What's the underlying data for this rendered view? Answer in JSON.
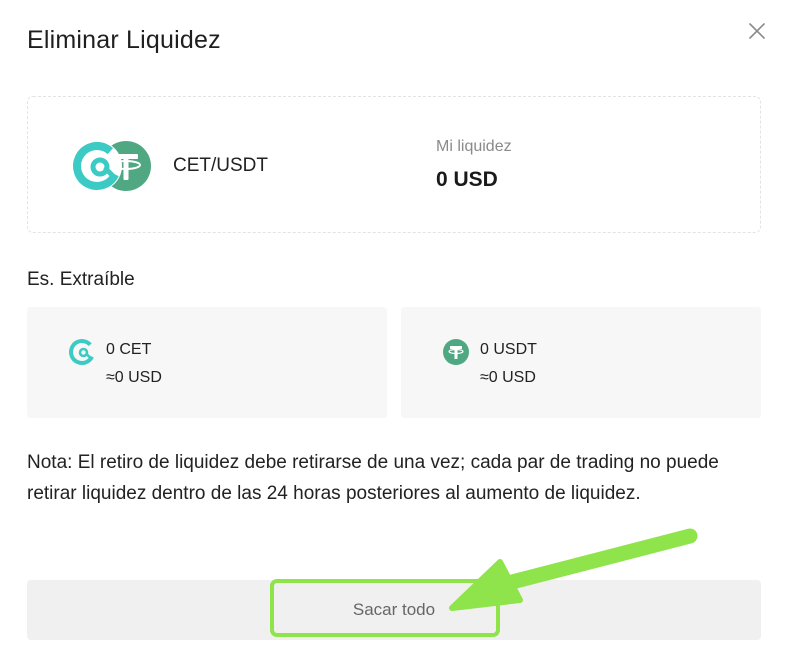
{
  "modal": {
    "title": "Eliminar Liquidez",
    "close_icon": "close-icon"
  },
  "pool": {
    "pair": "CET/USDT",
    "liquidity_label": "Mi liquidez",
    "liquidity_value": "0 USD"
  },
  "withdrawable": {
    "label": "Es. Extraíble",
    "assets": [
      {
        "amount": "0 CET",
        "usd": "≈0 USD",
        "icon": "cet-coin-icon"
      },
      {
        "amount": "0 USDT",
        "usd": "≈0 USD",
        "icon": "usdt-coin-icon"
      }
    ]
  },
  "note": "Nota: El retiro de liquidez debe retirarse de una vez; cada par de trading no puede retirar liquidez dentro de las 24 horas posteriores al aumento de liquidez.",
  "actions": {
    "withdraw_all_label": "Sacar todo"
  },
  "colors": {
    "cet_teal": "#3ccbc4",
    "usdt_green": "#50a883",
    "highlight_green": "#8fe34b",
    "button_bg": "#f0f0f0"
  }
}
